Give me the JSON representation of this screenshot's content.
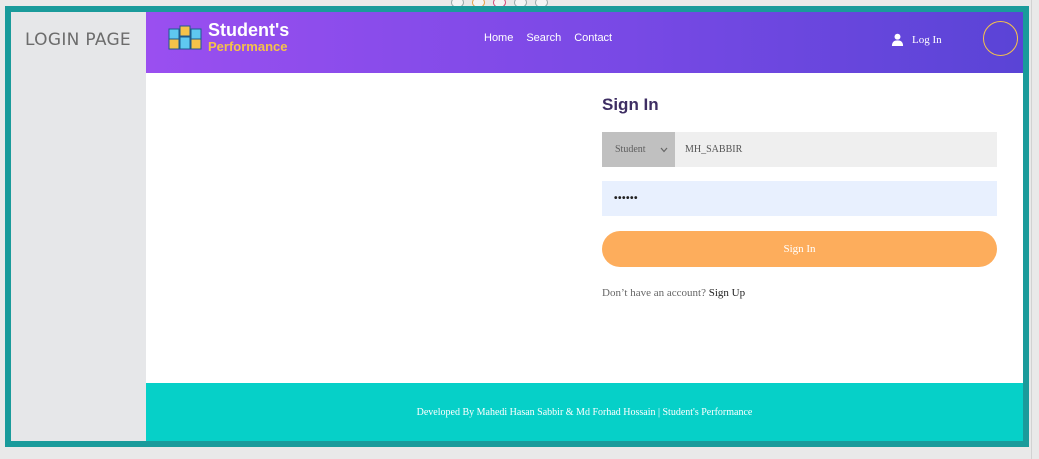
{
  "sidebar": {
    "title": "LOGIN PAGE"
  },
  "brand": {
    "name": "Student's",
    "tagline": "Performance"
  },
  "nav": {
    "links": [
      "Home",
      "Search",
      "Contact"
    ],
    "login_label": "Log In"
  },
  "signin": {
    "title": "Sign In",
    "role_selected": "Student",
    "username_value": "MH_SABBIR",
    "password_value": "••••••",
    "button_label": "Sign In",
    "signup_prompt": "Don’t have an account?",
    "signup_link": "Sign Up"
  },
  "footer": {
    "text": "Developed By Mahedi Hasan Sabbir & Md Forhad Hossain | Student's Performance"
  },
  "colors": {
    "frame": "#1a9b9b",
    "nav_gradient_start": "#9a4ff0",
    "nav_gradient_end": "#5a44d6",
    "accent_orange": "#fdad5c",
    "footer_bg": "#06d0c8",
    "brand_yellow": "#f5c24a"
  },
  "icons": {
    "logo": "cubes-icon",
    "user": "user-icon",
    "dropdown": "chevron-down-icon"
  }
}
